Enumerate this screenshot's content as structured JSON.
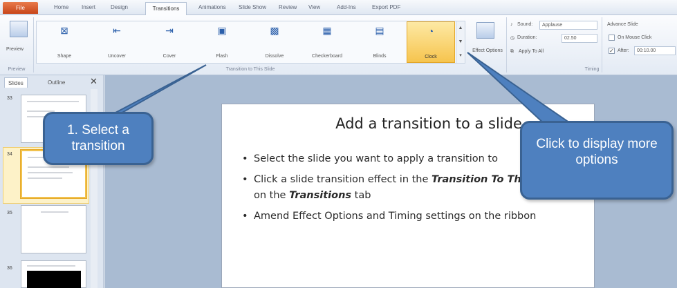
{
  "tabs": [
    "File",
    "Home",
    "Insert",
    "Design",
    "Transitions",
    "Animations",
    "Slide Show",
    "Review",
    "View",
    "Add-Ins",
    "Export PDF"
  ],
  "active_tab": "Transitions",
  "ribbon": {
    "preview_label": "Preview",
    "preview_group": "Preview",
    "transitions": [
      {
        "label": "Shape",
        "icon": "shape-transition-icon"
      },
      {
        "label": "Uncover",
        "icon": "uncover-transition-icon"
      },
      {
        "label": "Cover",
        "icon": "cover-transition-icon"
      },
      {
        "label": "Flash",
        "icon": "flash-transition-icon"
      },
      {
        "label": "Dissolve",
        "icon": "dissolve-transition-icon"
      },
      {
        "label": "Checkerboard",
        "icon": "checkerboard-transition-icon"
      },
      {
        "label": "Blinds",
        "icon": "blinds-transition-icon"
      },
      {
        "label": "Clock",
        "icon": "clock-transition-icon"
      }
    ],
    "selected_transition": "Clock",
    "transition_group": "Transition to This Slide",
    "effect_options_label": "Effect Options",
    "timing": {
      "sound_label": "Sound:",
      "sound_value": "Applause",
      "duration_label": "Duration:",
      "duration_value": "02.50",
      "apply_to_all": "Apply To All",
      "advance_slide": "Advance Slide",
      "on_mouse_click": "On Mouse Click",
      "on_mouse_click_checked": false,
      "after_label": "After:",
      "after_value": "00:10.00",
      "after_checked": true,
      "group_label": "Timing"
    }
  },
  "slides_pane": {
    "tabs": [
      "Slides",
      "Outline"
    ],
    "active": "Slides",
    "close_glyph": "✕",
    "thumbnails": [
      {
        "number": "33"
      },
      {
        "number": "34",
        "selected": true
      },
      {
        "number": "35"
      },
      {
        "number": "36"
      }
    ]
  },
  "slide": {
    "title": "Add a transition to a slide",
    "bullets": [
      {
        "text": "Select the slide you want to apply a transition to"
      },
      {
        "prefix": "Click a slide transition effect in the ",
        "em1": "Transition To This Slide",
        "mid": " group on the ",
        "em2": "Transitions",
        "suffix": " tab"
      },
      {
        "text": "Amend Effect Options and Timing settings on the ribbon"
      }
    ]
  },
  "callouts": {
    "select_transition": "1. Select a transition",
    "more_options": "Click to display more options"
  },
  "colors": {
    "callout_fill": "#4e80bf",
    "callout_border": "#3a6292",
    "selected_tile": "#f6c44e",
    "ribbon_bg": "#e3eaf4"
  }
}
